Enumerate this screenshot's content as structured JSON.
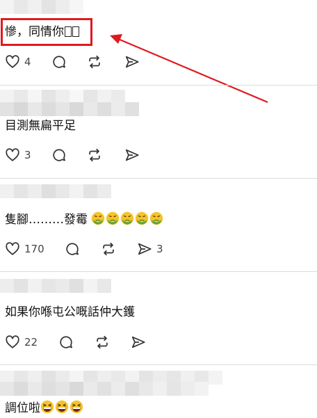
{
  "posts": [
    {
      "text": "慘，同情你",
      "unsupported_glyphs": 2,
      "highlighted": true,
      "actions": {
        "likes": "4",
        "comments": "",
        "reposts": "",
        "shares": ""
      }
    },
    {
      "text": "目測無扁平足",
      "actions": {
        "likes": "3",
        "comments": "",
        "reposts": "",
        "shares": ""
      }
    },
    {
      "text": "隻腳………發霉",
      "emoji": "nauseated-face",
      "emoji_count": 5,
      "actions": {
        "likes": "170",
        "comments": "",
        "reposts": "",
        "shares": "3"
      }
    },
    {
      "text": "如果你喺屯公嘅話仲大鑊",
      "actions": {
        "likes": "22",
        "comments": "",
        "reposts": "",
        "shares": ""
      }
    },
    {
      "text": "調位啦",
      "emoji": "grinning-squinting-face",
      "emoji_count": 3
    }
  ],
  "icons": [
    "heart-icon",
    "comment-icon",
    "repost-icon",
    "share-icon"
  ],
  "colors": {
    "annotation_red": "#e0191f",
    "icon_gray": "#444444",
    "divider": "#dcdcdc"
  }
}
